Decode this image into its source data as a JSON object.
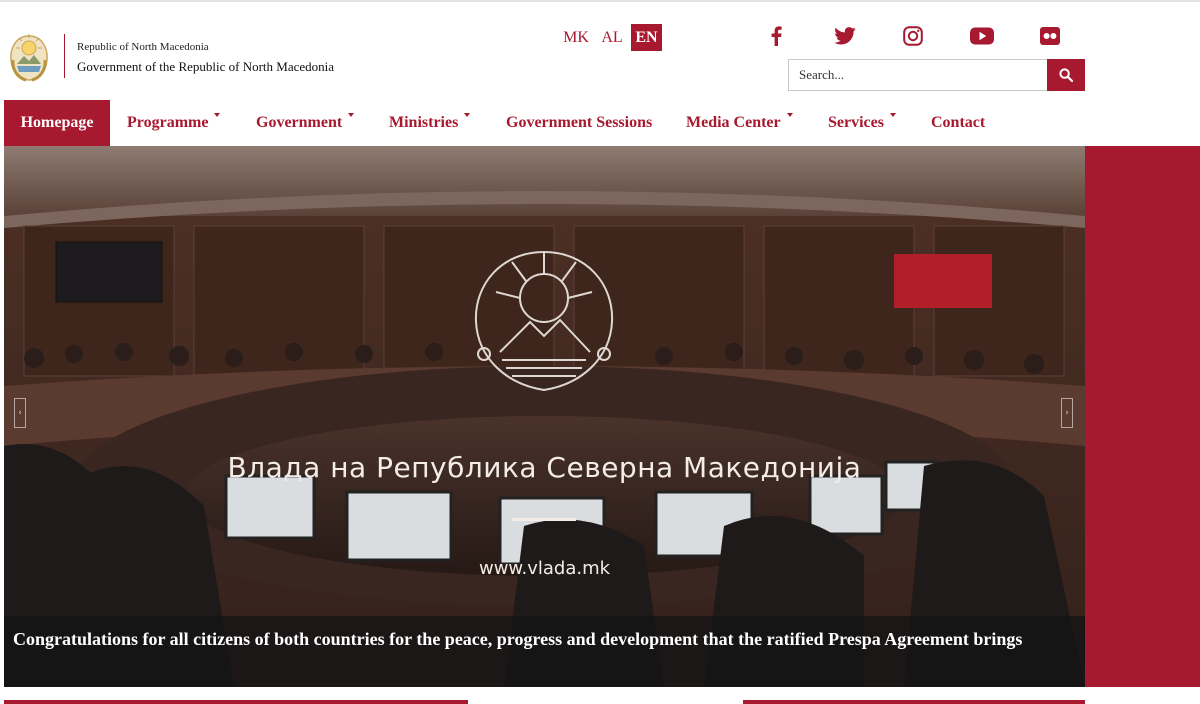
{
  "header": {
    "line1": "Republic of North Macedonia",
    "line2": "Government of the Republic of North Macedonia",
    "emblem_icon": "macedonia-emblem-icon"
  },
  "languages": [
    {
      "label": "MK",
      "active": false
    },
    {
      "label": "AL",
      "active": false
    },
    {
      "label": "EN",
      "active": true
    }
  ],
  "social": [
    "facebook-icon",
    "twitter-icon",
    "instagram-icon",
    "youtube-icon",
    "flickr-icon"
  ],
  "search": {
    "placeholder": "Search...",
    "value": "",
    "icon": "search-icon"
  },
  "nav": [
    {
      "label": "Homepage",
      "active": true,
      "dropdown": false
    },
    {
      "label": "Programme",
      "active": false,
      "dropdown": true
    },
    {
      "label": "Government",
      "active": false,
      "dropdown": true
    },
    {
      "label": "Ministries",
      "active": false,
      "dropdown": true
    },
    {
      "label": "Government Sessions",
      "active": false,
      "dropdown": false
    },
    {
      "label": "Media Center",
      "active": false,
      "dropdown": true
    },
    {
      "label": "Services",
      "active": false,
      "dropdown": true
    },
    {
      "label": "Contact",
      "active": false,
      "dropdown": false
    }
  ],
  "hero": {
    "title": "Влада на Република Северна Македонија",
    "url": "www.vlada.mk",
    "caption": "Congratulations for all citizens of both countries for the peace, progress and development that the ratified Prespa Agreement brings"
  },
  "colors": {
    "brand": "#a7192f",
    "caption_bg": "#141414"
  }
}
